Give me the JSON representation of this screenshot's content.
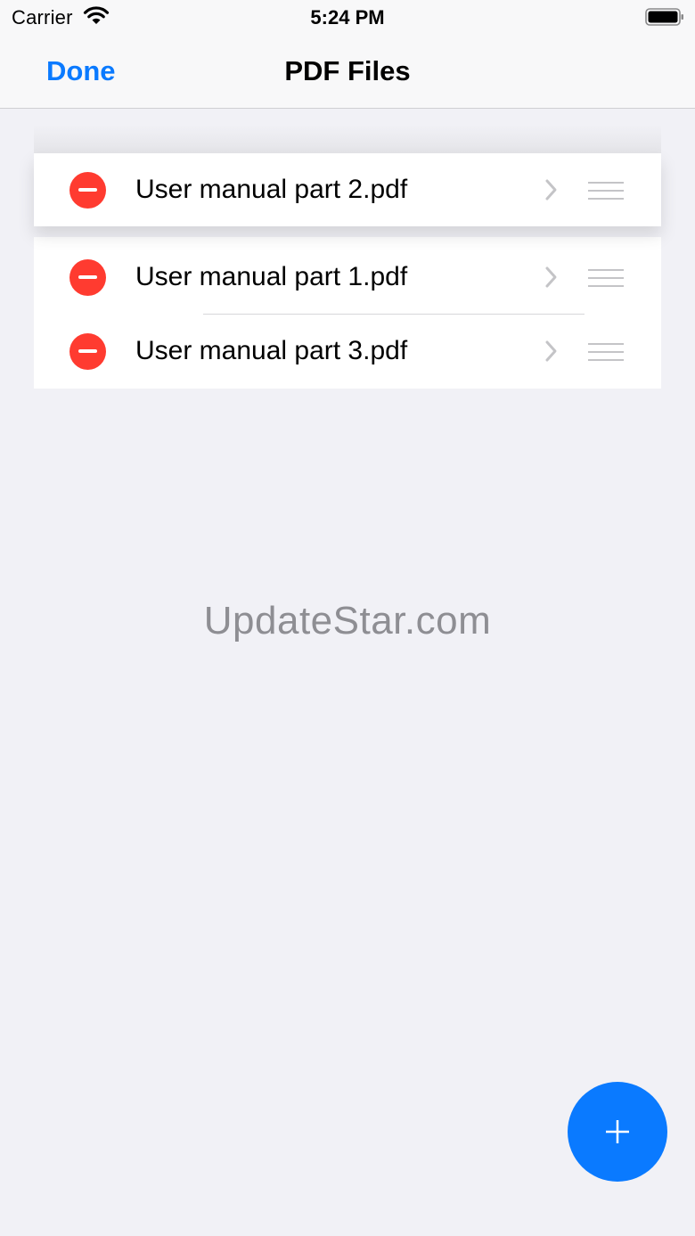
{
  "status_bar": {
    "carrier": "Carrier",
    "time": "5:24 PM",
    "icons": [
      "wifi-icon",
      "battery-icon"
    ]
  },
  "nav": {
    "done_label": "Done",
    "title": "PDF Files"
  },
  "files": [
    {
      "name": "User manual part 2.pdf",
      "state": "dragging"
    },
    {
      "name": "User manual part 1.pdf"
    },
    {
      "name": "User manual part 3.pdf"
    }
  ],
  "watermark": "UpdateStar.com",
  "add_button": {
    "icon": "plus-icon"
  },
  "colors": {
    "accent": "#0a7aff",
    "delete": "#ff3b30",
    "background": "#f1f1f6"
  }
}
